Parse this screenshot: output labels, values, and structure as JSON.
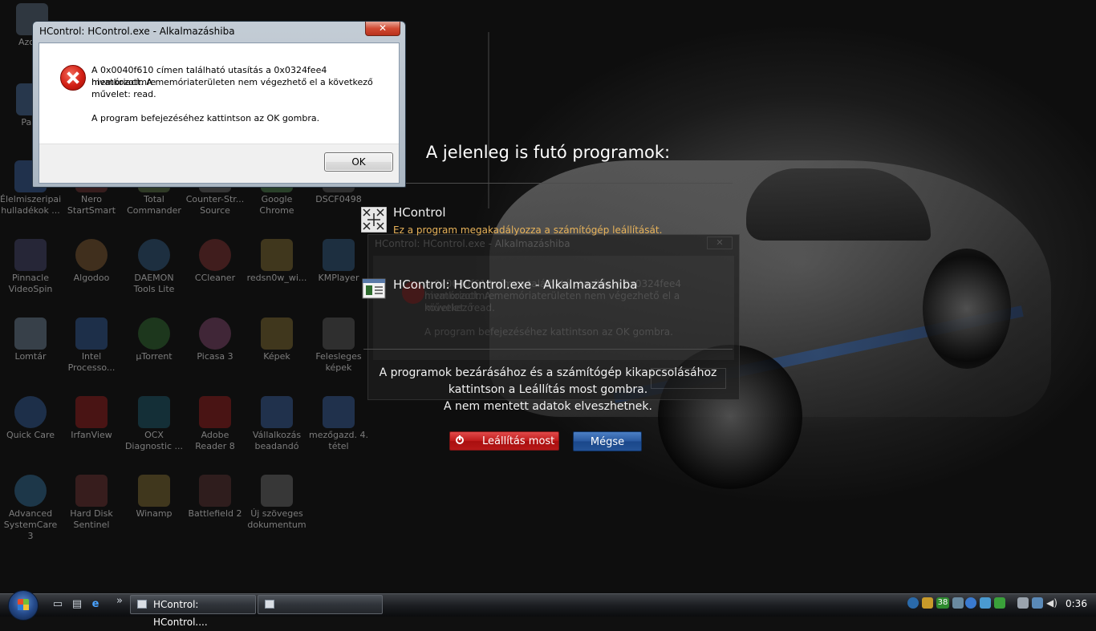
{
  "error_dialog": {
    "title": "HControl: HControl.exe - Alkalmazáshiba",
    "close_label": "✕",
    "message_line1": "A 0x0040f610 címen található utasítás a 0x0324fee4 memóriacímre",
    "message_line2": "hivatkozott. A memóriaterületen nem végezhető el a következő",
    "message_line3": "művelet: read.",
    "instruction": "A program befejezéséhez kattintson az OK gombra.",
    "ok_label": "OK"
  },
  "shutdown_overlay": {
    "title": "A jelenleg is futó programok:",
    "programs": [
      {
        "name": "HControl",
        "warning": "Ez a program megakadályozza a számítógép leállítását."
      },
      {
        "name": "HControl: HControl.exe - Alkalmazáshiba"
      }
    ],
    "message_line1": "A programok bezárásához és a számítógép kikapcsolásához",
    "message_line2": "kattintson a Leállítás most gombra.",
    "message_line3": "A nem mentett adatok elveszhetnek.",
    "shutdown_label": "Leállítás most",
    "cancel_label": "Mégse"
  },
  "desktop_icons": [
    {
      "label": "Azonn",
      "icon": "folder-icon"
    },
    {
      "label": "Paint",
      "icon": "paint-icon"
    },
    {
      "label": "Élelmiszeripai hulladékok ...",
      "icon": "word-document-icon"
    },
    {
      "label": "Nero StartSmart",
      "icon": "nero-icon"
    },
    {
      "label": "Total Commander",
      "icon": "floppy-icon"
    },
    {
      "label": "Counter-Str... Source",
      "icon": "game-icon"
    },
    {
      "label": "Google Chrome",
      "icon": "chrome-icon"
    },
    {
      "label": "DSCF0498",
      "icon": "image-icon"
    },
    {
      "label": "Pinnacle VideoSpin",
      "icon": "video-icon"
    },
    {
      "label": "Algodoo",
      "icon": "algodoo-icon"
    },
    {
      "label": "DAEMON Tools Lite",
      "icon": "daemon-icon"
    },
    {
      "label": "CCleaner",
      "icon": "ccleaner-icon"
    },
    {
      "label": "redsn0w_wi...",
      "icon": "folder-icon"
    },
    {
      "label": "KMPlayer",
      "icon": "kmplayer-icon"
    },
    {
      "label": "Lomtár",
      "icon": "recycle-bin-icon"
    },
    {
      "label": "Intel Processo...",
      "icon": "intel-icon"
    },
    {
      "label": "µTorrent",
      "icon": "utorrent-icon"
    },
    {
      "label": "Picasa 3",
      "icon": "picasa-icon"
    },
    {
      "label": "Képek",
      "icon": "folder-icon"
    },
    {
      "label": "Felesleges képek",
      "icon": "camera-icon"
    },
    {
      "label": "Quick Care",
      "icon": "shield-icon"
    },
    {
      "label": "IrfanView",
      "icon": "irfanview-icon"
    },
    {
      "label": "OCX Diagnostic ...",
      "icon": "wifi-icon"
    },
    {
      "label": "Adobe Reader 8",
      "icon": "pdf-icon"
    },
    {
      "label": "Vállalkozás beadandó",
      "icon": "word-document-icon"
    },
    {
      "label": "mezőgazd. 4. tétel",
      "icon": "word-document-icon"
    },
    {
      "label": "Advanced SystemCare 3",
      "icon": "systemcare-icon"
    },
    {
      "label": "Hard Disk Sentinel",
      "icon": "disk-icon"
    },
    {
      "label": "Winamp",
      "icon": "winamp-icon"
    },
    {
      "label": "Battlefield 2",
      "icon": "game-icon"
    },
    {
      "label": "Új szöveges dokumentum",
      "icon": "text-document-icon"
    }
  ],
  "taskbar": {
    "quick_launch_more": "»",
    "tasks": [
      {
        "label": "HControl: HControl...."
      },
      {
        "label": ""
      }
    ],
    "tray_counter": "38",
    "clock": "0:36",
    "colors": {
      "accent": "#2a5aa0",
      "danger": "#c11d1d",
      "warning_text": "#e8b35a"
    }
  }
}
